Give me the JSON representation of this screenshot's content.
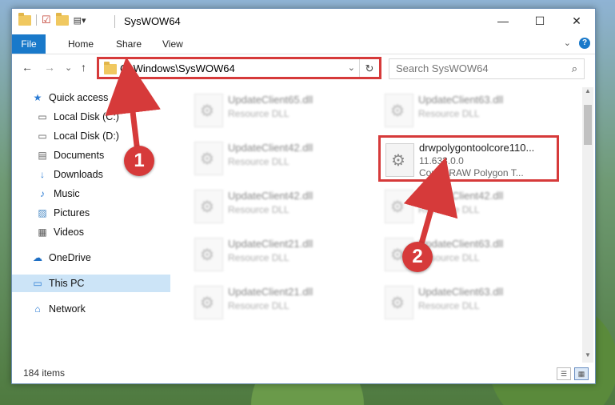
{
  "window": {
    "title": "SysWOW64",
    "controls": {
      "minimize": "—",
      "maximize": "☐",
      "close": "✕"
    }
  },
  "ribbon": {
    "tabs": [
      "File",
      "Home",
      "Share",
      "View"
    ],
    "expand_glyph": "⌄",
    "help_glyph": "?"
  },
  "nav": {
    "back_glyph": "←",
    "forward_glyph": "→",
    "recent_glyph": "⌄",
    "up_glyph": "↑",
    "address": "C:\\Windows\\SysWOW64",
    "address_drop_glyph": "⌄",
    "refresh_glyph": "↻",
    "search_placeholder": "Search SysWOW64",
    "search_glyph": "⌕"
  },
  "sidebar": {
    "items": [
      {
        "label": "Quick access",
        "icon": "star-icon",
        "glyph": "★",
        "pinned": false
      },
      {
        "label": "Local Disk (C:)",
        "icon": "drive-icon",
        "glyph": "▭",
        "pinned": true
      },
      {
        "label": "Local Disk (D:)",
        "icon": "drive-icon",
        "glyph": "▭",
        "pinned": true
      },
      {
        "label": "Documents",
        "icon": "documents-icon",
        "glyph": "▤",
        "pinned": true
      },
      {
        "label": "Downloads",
        "icon": "download-icon",
        "glyph": "↓",
        "pinned": true
      },
      {
        "label": "Music",
        "icon": "music-icon",
        "glyph": "♪",
        "pinned": true
      },
      {
        "label": "Pictures",
        "icon": "pictures-icon",
        "glyph": "▨",
        "pinned": true
      },
      {
        "label": "Videos",
        "icon": "videos-icon",
        "glyph": "▦",
        "pinned": true
      },
      {
        "label": "OneDrive",
        "icon": "cloud-icon",
        "glyph": "☁",
        "pinned": false
      },
      {
        "label": "This PC",
        "icon": "computer-icon",
        "glyph": "▭",
        "pinned": false
      },
      {
        "label": "Network",
        "icon": "network-icon",
        "glyph": "⌂",
        "pinned": false
      }
    ],
    "pin_glyph": "📌"
  },
  "files": {
    "left_column": [
      {
        "name": "UpdateClient65.dll",
        "type": "Resource DLL"
      },
      {
        "name": "UpdateClient42.dll",
        "type": "Resource DLL"
      },
      {
        "name": "UpdateClient42.dll",
        "type": "Resource DLL"
      },
      {
        "name": "UpdateClient21.dll",
        "type": "Resource DLL"
      },
      {
        "name": "UpdateClient21.dll",
        "type": "Resource DLL"
      }
    ],
    "right_column": [
      {
        "name": "UpdateClient63.dll",
        "type": "Resource DLL"
      },
      {
        "name": "UpdateClient42.dll",
        "type": "Resource DLL"
      },
      {
        "name": "UpdateClient63.dll",
        "type": "Resource DLL"
      },
      {
        "name": "UpdateClient63.dll",
        "type": "Resource DLL"
      }
    ],
    "highlighted": {
      "name": "drwpolygontoolcore110...",
      "version": "11.633.0.0",
      "description": "CorelDRAW Polygon T..."
    }
  },
  "annotations": {
    "step1": "1",
    "step2": "2",
    "color": "#d63a3a"
  },
  "status": {
    "items_count": "184 items"
  }
}
